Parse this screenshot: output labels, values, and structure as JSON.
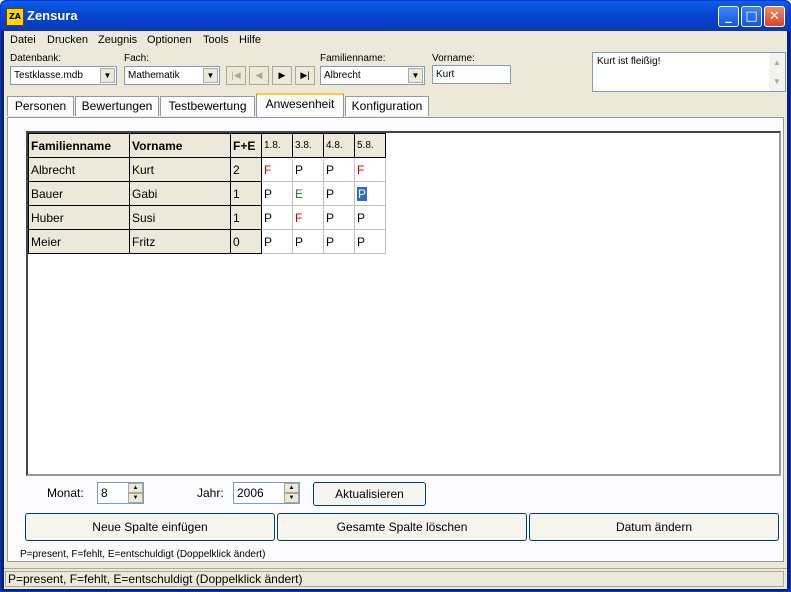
{
  "window": {
    "title": "Zensura",
    "icon_text": "ZA"
  },
  "menu": [
    "Datei",
    "Drucken",
    "Zeugnis",
    "Optionen",
    "Tools",
    "Hilfe"
  ],
  "toolbar": {
    "datenbank_label": "Datenbank:",
    "datenbank_value": "Testklasse.mdb",
    "fach_label": "Fach:",
    "fach_value": "Mathematik",
    "familienname_label": "Familienname:",
    "familienname_value": "Albrecht",
    "vorname_label": "Vorname:",
    "vorname_value": "Kurt",
    "memo": "Kurt ist fleißig!"
  },
  "tabs": [
    "Personen",
    "Bewertungen",
    "Testbewertung",
    "Anwesenheit",
    "Konfiguration"
  ],
  "grid": {
    "headers": [
      "Familienname",
      "Vorname",
      "F+E",
      "1.8.",
      "3.8.",
      "4.8.",
      "5.8."
    ],
    "rows": [
      {
        "familienname": "Albrecht",
        "vorname": "Kurt",
        "fe": "2",
        "d1": "F",
        "d2": "P",
        "d3": "P",
        "d4": "F"
      },
      {
        "familienname": "Bauer",
        "vorname": "Gabi",
        "fe": "1",
        "d1": "P",
        "d2": "E",
        "d3": "P",
        "d4": "P"
      },
      {
        "familienname": "Huber",
        "vorname": "Susi",
        "fe": "1",
        "d1": "P",
        "d2": "F",
        "d3": "P",
        "d4": "P"
      },
      {
        "familienname": "Meier",
        "vorname": "Fritz",
        "fe": "0",
        "d1": "P",
        "d2": "P",
        "d3": "P",
        "d4": "P"
      }
    ]
  },
  "controls": {
    "monat_label": "Monat:",
    "monat_value": "8",
    "jahr_label": "Jahr:",
    "jahr_value": "2006",
    "aktualisieren": "Aktualisieren",
    "neue_spalte": "Neue Spalte einfügen",
    "spalte_loeschen": "Gesamte Spalte löschen",
    "datum_aendern": "Datum ändern"
  },
  "hint": "P=present, F=fehlt, E=entschuldigt (Doppelklick ändert)",
  "status": "P=present, F=fehlt, E=entschuldigt (Doppelklick ändert)",
  "colors": {
    "fehlt": "#c00000",
    "entschuldigt": "#208020",
    "selected": "#316ac5"
  }
}
